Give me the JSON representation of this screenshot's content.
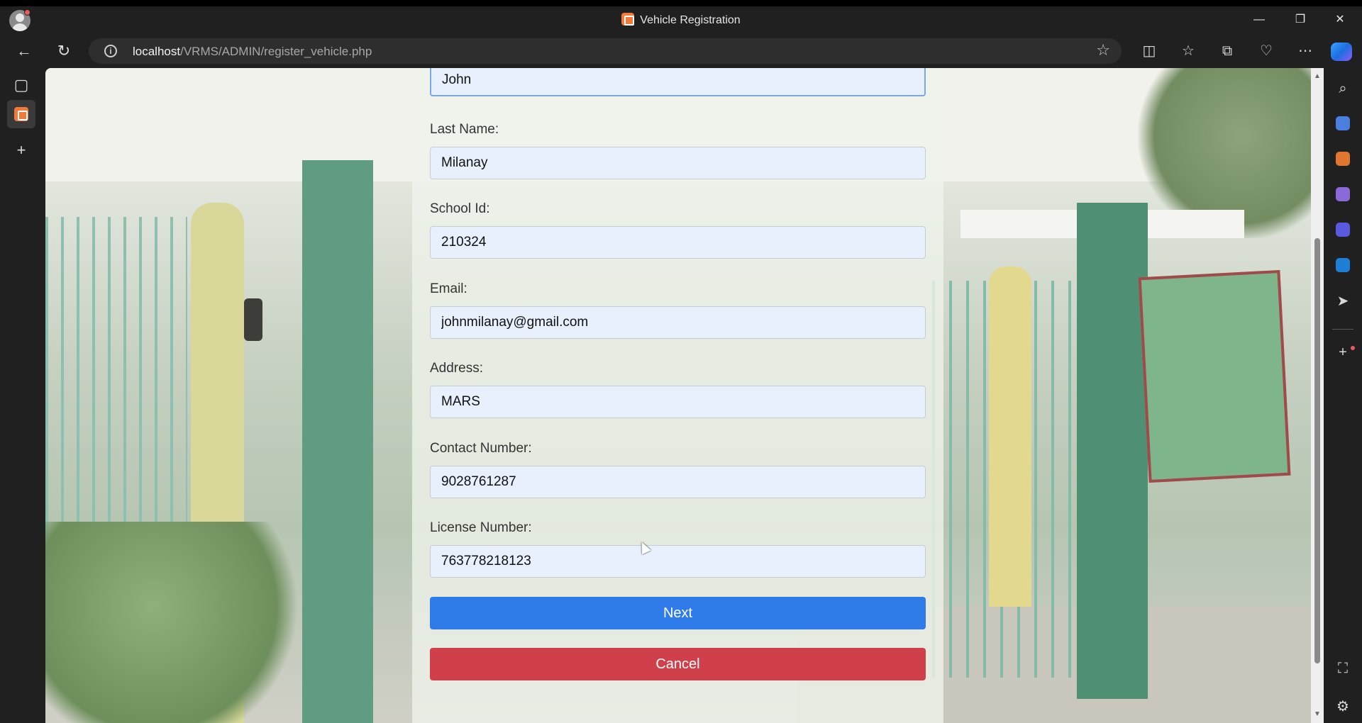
{
  "window": {
    "title": "Vehicle Registration",
    "minimize_glyph": "—",
    "restore_glyph": "❐",
    "close_glyph": "✕"
  },
  "navbar": {
    "back_glyph": "←",
    "reload_glyph": "↻",
    "url_host": "localhost",
    "url_path": "/VRMS/ADMIN/register_vehicle.php",
    "info_glyph": "i",
    "star_glyph": "☆"
  },
  "toolbar_icons": [
    "split-screen-icon",
    "favorites-icon",
    "collections-icon",
    "browser-essentials-icon",
    "more-icon",
    "copilot-icon"
  ],
  "left_tabs": [
    {
      "name": "tab-actions-icon",
      "glyph": "▢"
    },
    {
      "name": "xampp-tab-icon",
      "glyph": ""
    },
    {
      "name": "new-tab-icon",
      "glyph": "+"
    }
  ],
  "right_sidebar": [
    "search-icon",
    "shopping-icon",
    "tools-icon",
    "games-icon",
    "microsoft-365-icon",
    "outlook-icon",
    "drop-icon",
    "add-icon",
    "screenshot-icon",
    "settings-icon"
  ],
  "form": {
    "first_name_value": "John",
    "last_name_label": "Last Name:",
    "last_name_value": "Milanay",
    "school_id_label": "School Id:",
    "school_id_value": "210324",
    "email_label": "Email:",
    "email_value": "johnmilanay@gmail.com",
    "address_label": "Address:",
    "address_value": "MARS",
    "contact_label": "Contact Number:",
    "contact_value": "9028761287",
    "license_label": "License Number:",
    "license_value": "763778218123",
    "next_label": "Next",
    "cancel_label": "Cancel"
  },
  "colors": {
    "next_button": "#2f7bea",
    "cancel_button": "#d0404a",
    "input_background": "#e8f0fe"
  }
}
